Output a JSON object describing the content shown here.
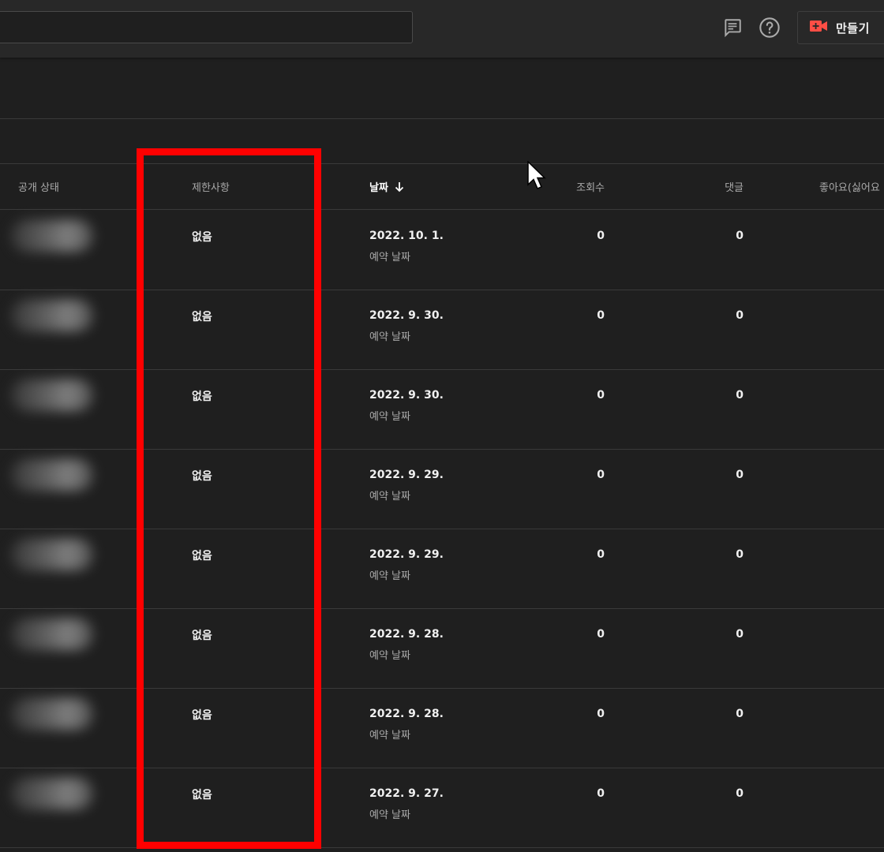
{
  "topbar": {
    "search_value": "",
    "feedback_icon": "feedback-icon",
    "help_icon": "help-icon",
    "create_label": "만들기",
    "create_icon_color": "#ff4e45"
  },
  "table": {
    "headers": {
      "visibility": "공개 상태",
      "restrictions": "제한사항",
      "date": "날짜",
      "views": "조회수",
      "comments": "댓글",
      "likes": "좋아요(싫어요"
    },
    "rows": [
      {
        "restriction": "없음",
        "date": "2022. 10. 1.",
        "date_sub": "예약 날짜",
        "views": "0",
        "comments": "0"
      },
      {
        "restriction": "없음",
        "date": "2022. 9. 30.",
        "date_sub": "예약 날짜",
        "views": "0",
        "comments": "0"
      },
      {
        "restriction": "없음",
        "date": "2022. 9. 30.",
        "date_sub": "예약 날짜",
        "views": "0",
        "comments": "0"
      },
      {
        "restriction": "없음",
        "date": "2022. 9. 29.",
        "date_sub": "예약 날짜",
        "views": "0",
        "comments": "0"
      },
      {
        "restriction": "없음",
        "date": "2022. 9. 29.",
        "date_sub": "예약 날짜",
        "views": "0",
        "comments": "0"
      },
      {
        "restriction": "없음",
        "date": "2022. 9. 28.",
        "date_sub": "예약 날짜",
        "views": "0",
        "comments": "0"
      },
      {
        "restriction": "없음",
        "date": "2022. 9. 28.",
        "date_sub": "예약 날짜",
        "views": "0",
        "comments": "0"
      },
      {
        "restriction": "없음",
        "date": "2022. 9. 27.",
        "date_sub": "예약 날짜",
        "views": "0",
        "comments": "0"
      }
    ]
  },
  "annotation": {
    "highlight_color": "#ff0000"
  }
}
